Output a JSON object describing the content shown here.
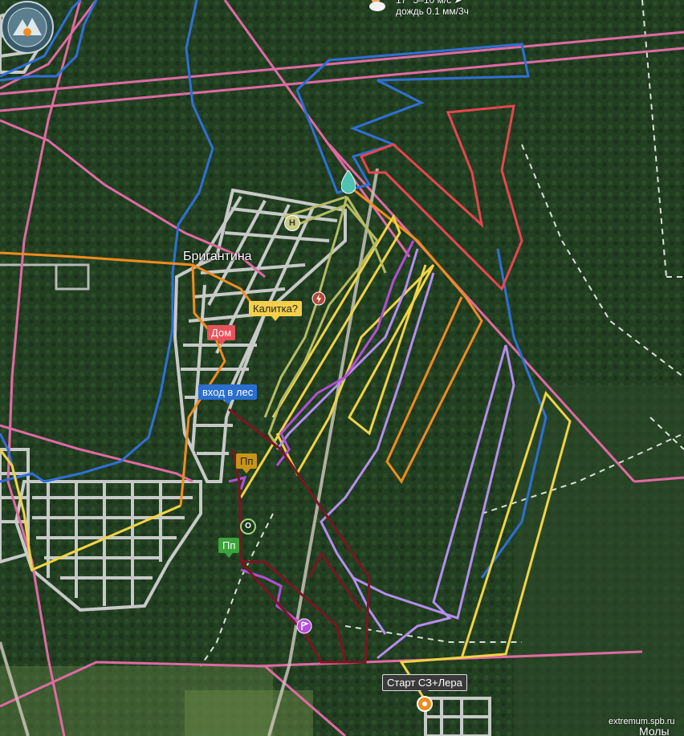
{
  "weather": {
    "line1": "17° 5–10 м/с ➤",
    "line2": "дождь 0.1 мм/3ч"
  },
  "places": {
    "main": "Бригантина",
    "partial": "Молы"
  },
  "labels": {
    "dom": "Дом",
    "kalitka": "Калитка?",
    "vhod": "вход в лес",
    "pp1": "Пп",
    "pp2": "Пп",
    "start": "Старт СЗ+Лера"
  },
  "markers": {
    "n": "Н",
    "o": "О"
  },
  "watermark": "extremum.spb.ru",
  "route_colors": {
    "blue": "#2f6fd6",
    "red": "#e8454f",
    "orange": "#f08c1e",
    "yellow": "#f2d442",
    "violet": "#b58ef0",
    "magenta": "#b34fd8",
    "olive": "#b7bb62",
    "maroon": "#7a1523",
    "pink": "#e06aa3"
  }
}
